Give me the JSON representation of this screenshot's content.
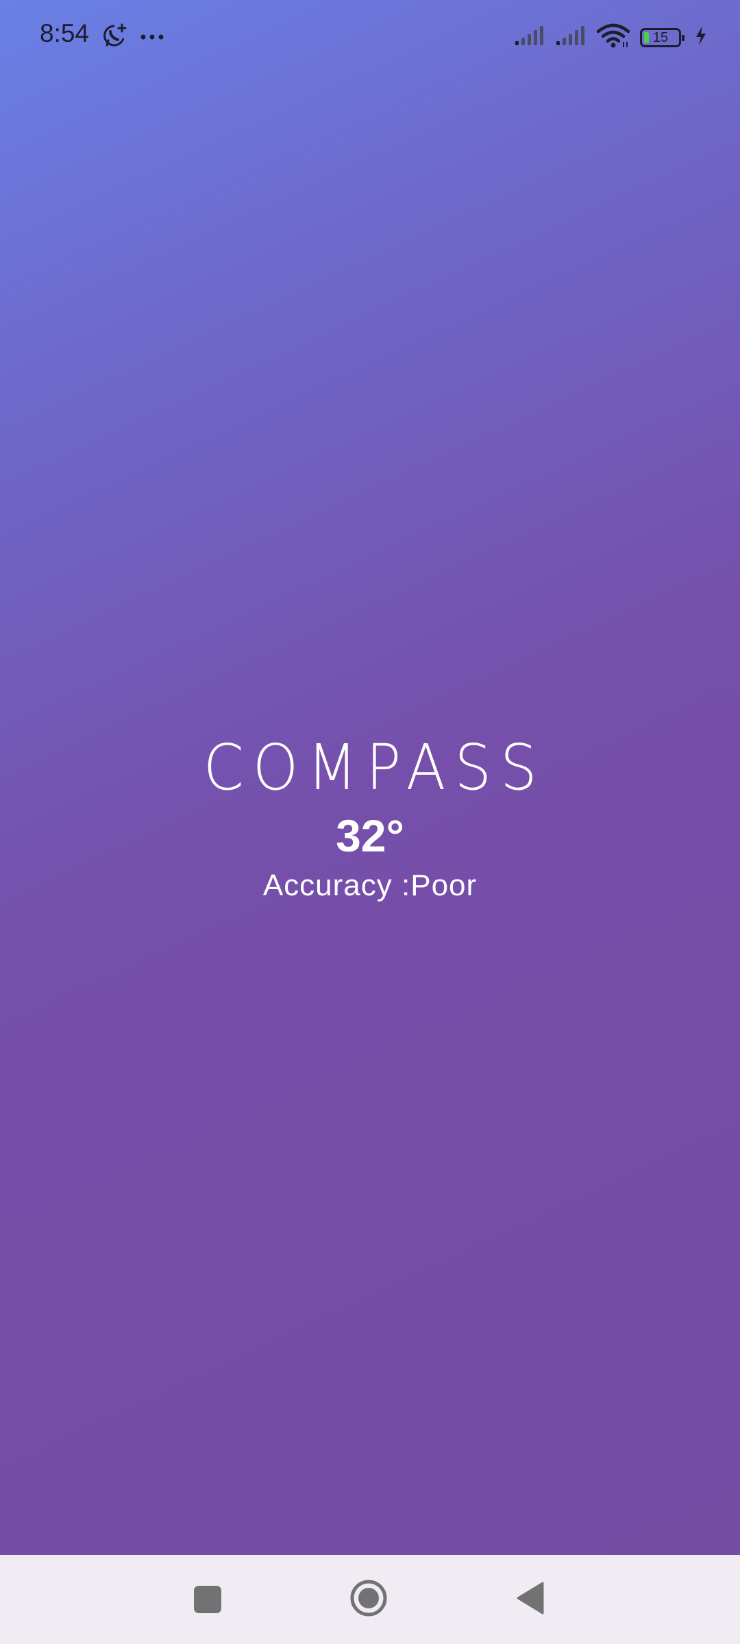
{
  "status_bar": {
    "time": "8:54",
    "left_icons": [
      "whatsapp-status-icon",
      "more-dots-icon"
    ],
    "right_icons": [
      "signal-1-icon",
      "signal-2-icon",
      "wifi-icon",
      "battery-icon",
      "charging-icon"
    ],
    "battery_level": "15",
    "battery_fraction": 0.15,
    "battery_fill_color": "#4cd04c"
  },
  "main": {
    "title": "COMPASS",
    "heading": "32°",
    "accuracy": "Accuracy :Poor"
  },
  "nav_bar": {
    "buttons": [
      "recents-icon",
      "home-icon",
      "back-icon"
    ]
  },
  "colors": {
    "gradient_start": "#6a80e6",
    "gradient_end": "#764ba2",
    "nav_background": "#f1ecf4",
    "text": "#ffffff"
  }
}
